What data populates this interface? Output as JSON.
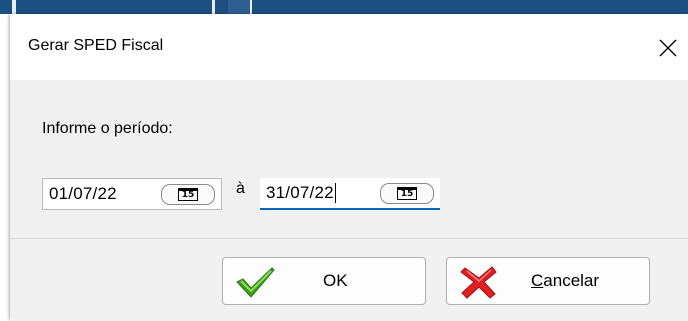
{
  "dialog": {
    "title": "Gerar SPED Fiscal",
    "close_icon": "close-icon"
  },
  "form": {
    "prompt": "Informe o período:",
    "start_date": "01/07/22",
    "separator": "à",
    "end_date": "31/07/22",
    "calendar_icon": "calendar-icon",
    "calendar_glyph": "15"
  },
  "buttons": {
    "ok_label": "OK",
    "ok_icon": "checkmark-icon",
    "cancel_label": "Cancelar",
    "cancel_icon": "x-icon"
  },
  "colors": {
    "focus_underline": "#0067c0",
    "ok_icon": "#3aa017",
    "cancel_icon": "#e02020"
  }
}
